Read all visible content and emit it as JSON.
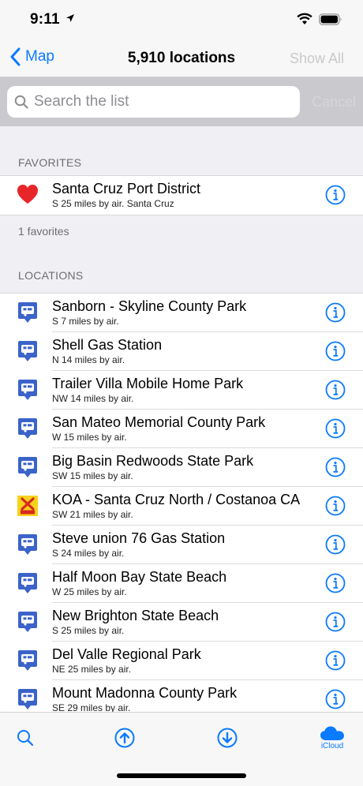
{
  "status_bar": {
    "time": "9:11"
  },
  "nav": {
    "back_label": "Map",
    "title": "5,910 locations",
    "right_label": "Show All"
  },
  "search": {
    "placeholder": "Search the list",
    "value": "",
    "cancel_label": "Cancel"
  },
  "favorites": {
    "header": "FAVORITES",
    "footer": "1 favorites",
    "items": [
      {
        "title": "Santa Cruz Port District",
        "subtitle": "S 25 miles by air. Santa Cruz",
        "icon": "heart-icon"
      }
    ]
  },
  "locations": {
    "header": "LOCATIONS",
    "items": [
      {
        "title": "Sanborn - Skyline County Park",
        "subtitle": "S 7 miles by air.",
        "icon": "rv-pin-icon"
      },
      {
        "title": "Shell Gas Station",
        "subtitle": "N 14 miles by air.",
        "icon": "rv-pin-icon"
      },
      {
        "title": "Trailer Villa Mobile Home Park",
        "subtitle": "NW 14 miles by air.",
        "icon": "rv-pin-icon"
      },
      {
        "title": "San Mateo Memorial County Park",
        "subtitle": "W 15 miles by air.",
        "icon": "rv-pin-icon"
      },
      {
        "title": "Big Basin Redwoods State Park",
        "subtitle": "SW 15 miles by air.",
        "icon": "rv-pin-icon"
      },
      {
        "title": "KOA - Santa Cruz North / Costanoa CA",
        "subtitle": "SW 21 miles by air.",
        "icon": "koa-logo-icon"
      },
      {
        "title": "Steve union 76 Gas Station",
        "subtitle": "S 24 miles by air.",
        "icon": "rv-pin-icon"
      },
      {
        "title": "Half Moon Bay State Beach",
        "subtitle": "W 25 miles by air.",
        "icon": "rv-pin-icon"
      },
      {
        "title": "New Brighton State Beach",
        "subtitle": "S 25 miles by air.",
        "icon": "rv-pin-icon"
      },
      {
        "title": "Del Valle Regional Park",
        "subtitle": "NE 25 miles by air.",
        "icon": "rv-pin-icon"
      },
      {
        "title": "Mount Madonna County Park",
        "subtitle": "SE 29 miles by air.",
        "icon": "rv-pin-icon"
      },
      {
        "title": "",
        "subtitle": "",
        "icon": "rv-pin-icon"
      }
    ]
  },
  "tab_bar": {
    "tabs": [
      {
        "icon": "search-icon",
        "label": ""
      },
      {
        "icon": "upload-icon",
        "label": ""
      },
      {
        "icon": "download-icon",
        "label": ""
      },
      {
        "icon": "icloud-icon",
        "label": "iCloud"
      }
    ]
  },
  "colors": {
    "accent": "#0a7aff",
    "heart": "#e8262a",
    "pin": "#3b63c9",
    "koa_yellow": "#f7d21b",
    "koa_red": "#d8281f"
  }
}
